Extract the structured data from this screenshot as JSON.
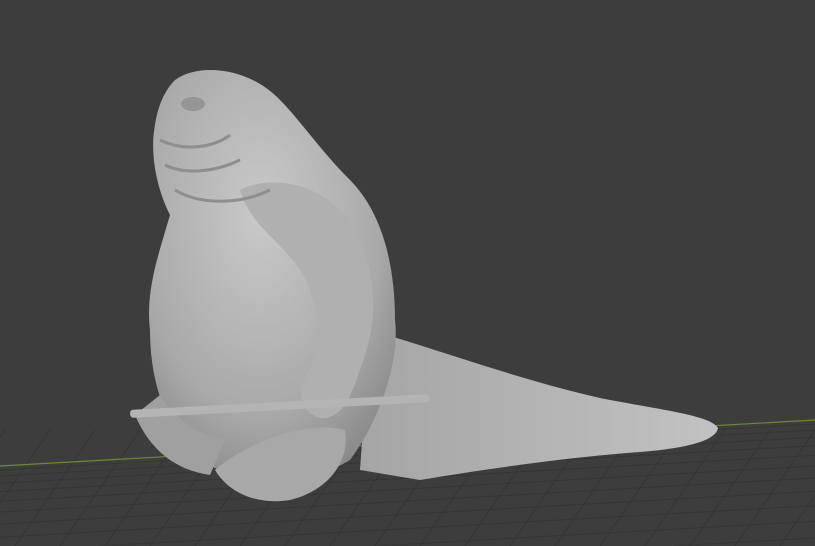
{
  "viewport": {
    "background_color": "#3d3d3d",
    "grid_color": "#353535",
    "x_axis_color": "#6b8a2e",
    "model_color": "#b8b8b8"
  }
}
